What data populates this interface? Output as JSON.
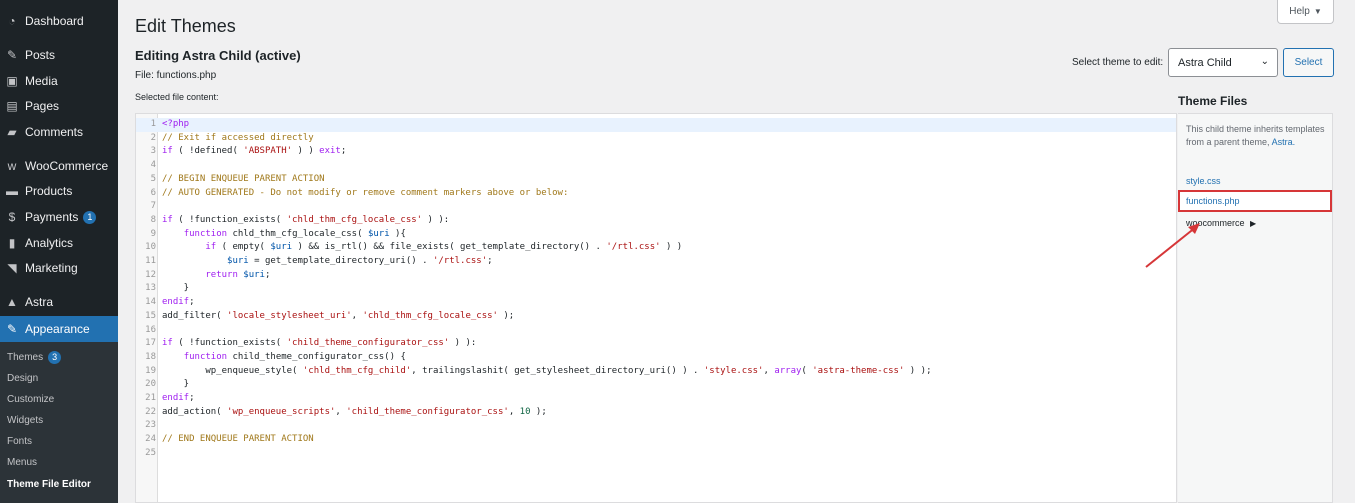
{
  "sidebar": {
    "items": [
      {
        "label": "Dashboard",
        "icon": "dashboard-icon"
      },
      {
        "label": "Posts",
        "icon": "pin-icon"
      },
      {
        "label": "Media",
        "icon": "media-icon"
      },
      {
        "label": "Pages",
        "icon": "pages-icon"
      },
      {
        "label": "Comments",
        "icon": "comments-icon"
      },
      {
        "label": "WooCommerce",
        "icon": "woocommerce-icon"
      },
      {
        "label": "Products",
        "icon": "products-icon"
      },
      {
        "label": "Payments",
        "icon": "payments-icon",
        "badge": "1"
      },
      {
        "label": "Analytics",
        "icon": "analytics-icon"
      },
      {
        "label": "Marketing",
        "icon": "marketing-icon"
      },
      {
        "label": "Astra",
        "icon": "astra-icon"
      },
      {
        "label": "Appearance",
        "icon": "appearance-icon"
      }
    ],
    "submenu": [
      {
        "label": "Themes",
        "badge": "3"
      },
      {
        "label": "Design"
      },
      {
        "label": "Customize"
      },
      {
        "label": "Widgets"
      },
      {
        "label": "Fonts"
      },
      {
        "label": "Menus"
      },
      {
        "label": "Theme File Editor"
      }
    ]
  },
  "header": {
    "title": "Edit Themes",
    "help_label": "Help"
  },
  "editor": {
    "editing_heading": "Editing Astra Child (active)",
    "file_label": "File: functions.php",
    "selected_content_label": "Selected file content:",
    "select_theme_label": "Select theme to edit:",
    "selected_theme": "Astra Child",
    "select_button": "Select",
    "lines": [
      "<?php",
      "// Exit if accessed directly",
      "if ( !defined( 'ABSPATH' ) ) exit;",
      "",
      "// BEGIN ENQUEUE PARENT ACTION",
      "// AUTO GENERATED - Do not modify or remove comment markers above or below:",
      "",
      "if ( !function_exists( 'chld_thm_cfg_locale_css' ) ):",
      "    function chld_thm_cfg_locale_css( $uri ){",
      "        if ( empty( $uri ) && is_rtl() && file_exists( get_template_directory() . '/rtl.css' ) )",
      "            $uri = get_template_directory_uri() . '/rtl.css';",
      "        return $uri;",
      "    }",
      "endif;",
      "add_filter( 'locale_stylesheet_uri', 'chld_thm_cfg_locale_css' );",
      "",
      "if ( !function_exists( 'child_theme_configurator_css' ) ):",
      "    function child_theme_configurator_css() {",
      "        wp_enqueue_style( 'chld_thm_cfg_child', trailingslashit( get_stylesheet_directory_uri() ) . 'style.css', array( 'astra-theme-css' ) );",
      "    }",
      "endif;",
      "add_action( 'wp_enqueue_scripts', 'child_theme_configurator_css', 10 );",
      "",
      "// END ENQUEUE PARENT ACTION",
      ""
    ]
  },
  "theme_files": {
    "title": "Theme Files",
    "note_text": "This child theme inherits templates from a parent theme,",
    "note_link": "Astra.",
    "files": [
      "style.css",
      "functions.php"
    ],
    "folder": "woocommerce"
  },
  "colors": {
    "sidebar_bg": "#1d2327",
    "accent": "#2271b1",
    "highlight": "#d63638"
  }
}
